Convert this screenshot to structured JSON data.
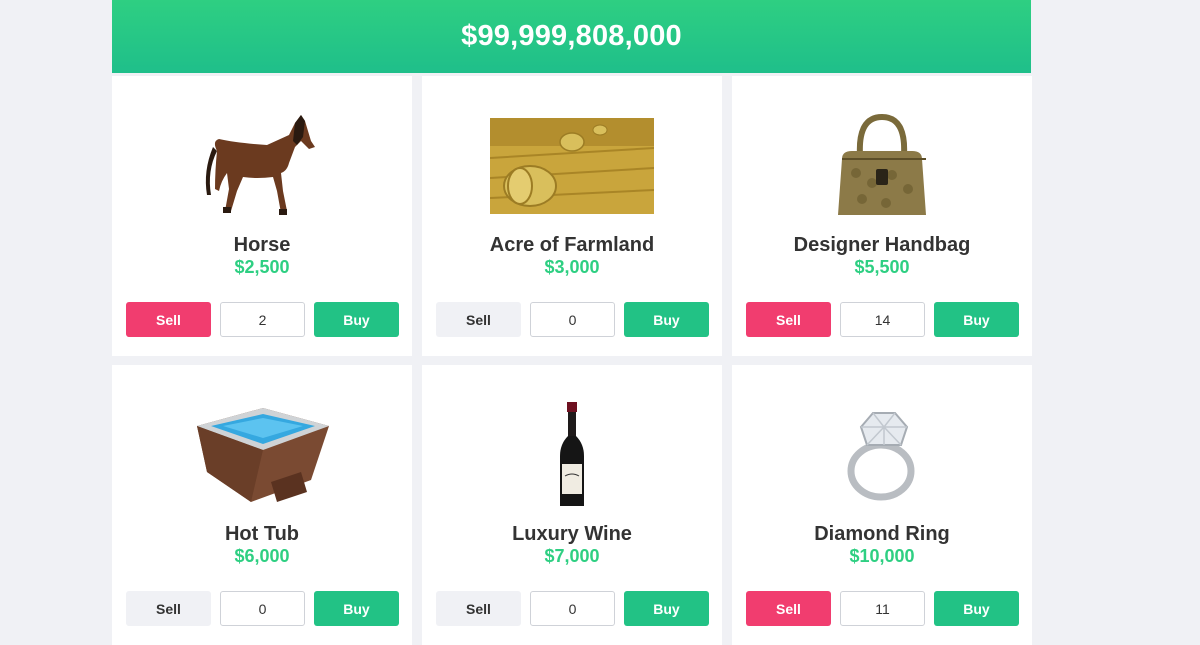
{
  "balance": "$99,999,808,000",
  "products": [
    {
      "name": "Horse",
      "price": "$2,500",
      "qty": "2",
      "sell_label": "Sell",
      "buy_label": "Buy",
      "sell_enabled": true,
      "image_icon": "horse-icon"
    },
    {
      "name": "Acre of Farmland",
      "price": "$3,000",
      "qty": "0",
      "sell_label": "Sell",
      "buy_label": "Buy",
      "sell_enabled": false,
      "image_icon": "farmland-icon"
    },
    {
      "name": "Designer Handbag",
      "price": "$5,500",
      "qty": "14",
      "sell_label": "Sell",
      "buy_label": "Buy",
      "sell_enabled": true,
      "image_icon": "handbag-icon"
    },
    {
      "name": "Hot Tub",
      "price": "$6,000",
      "qty": "0",
      "sell_label": "Sell",
      "buy_label": "Buy",
      "sell_enabled": false,
      "image_icon": "hot-tub-icon"
    },
    {
      "name": "Luxury Wine",
      "price": "$7,000",
      "qty": "0",
      "sell_label": "Sell",
      "buy_label": "Buy",
      "sell_enabled": false,
      "image_icon": "wine-bottle-icon"
    },
    {
      "name": "Diamond Ring",
      "price": "$10,000",
      "qty": "11",
      "sell_label": "Sell",
      "buy_label": "Buy",
      "sell_enabled": true,
      "image_icon": "diamond-ring-icon"
    }
  ],
  "colors": {
    "accent": "#2ecf82",
    "sell": "#f13d6f",
    "sell_disabled": "#f0f1f5",
    "buy": "#22c285"
  }
}
